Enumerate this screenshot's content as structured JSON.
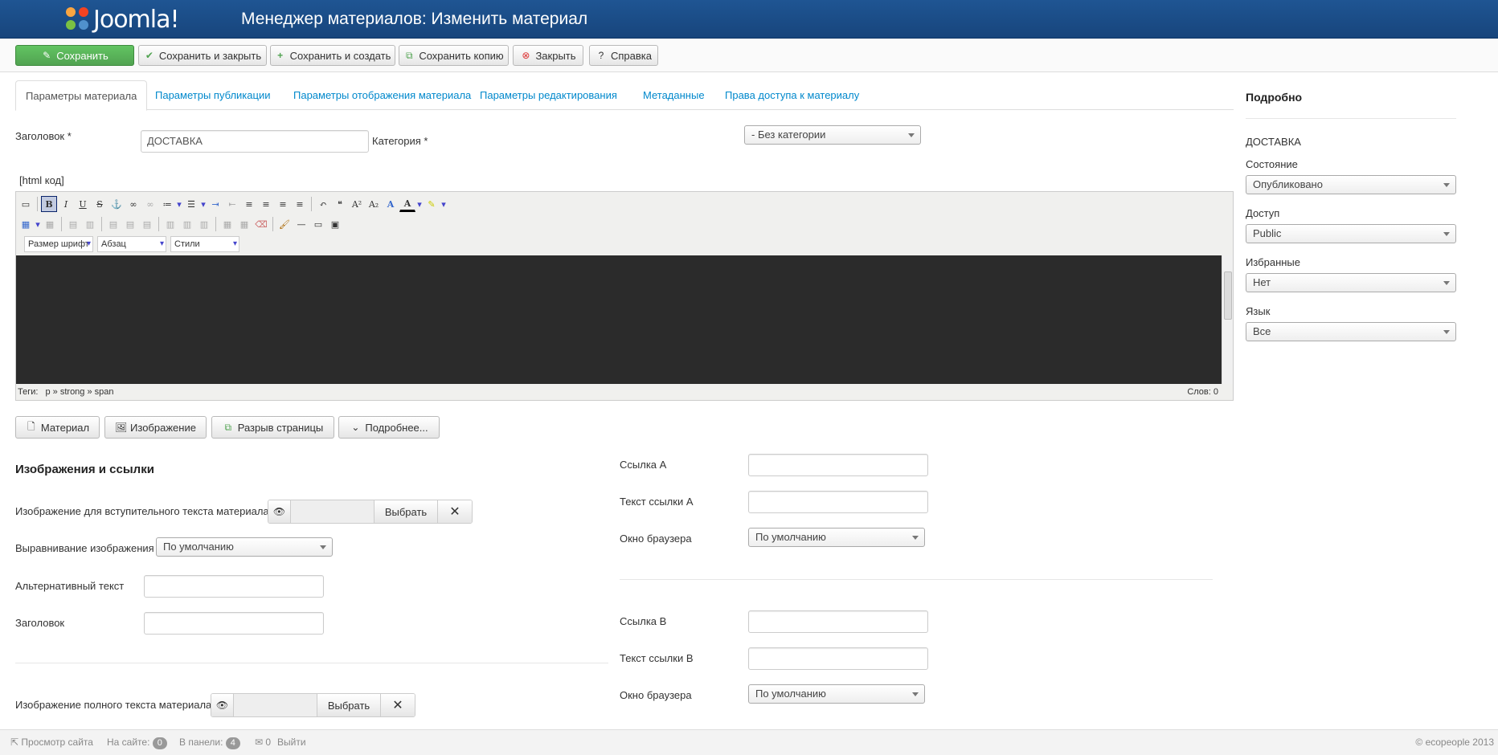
{
  "header": {
    "logo_text": "Joomla!",
    "title": "Менеджер материалов: Изменить материал"
  },
  "toolbar": {
    "save": "Сохранить",
    "save_close": "Сохранить и закрыть",
    "save_new": "Сохранить и создать",
    "save_copy": "Сохранить копию",
    "close": "Закрыть",
    "help": "Справка"
  },
  "tabs": [
    "Параметры материала",
    "Параметры публикации",
    "Параметры отображения материала",
    "Параметры редактирования",
    "Метаданные",
    "Права доступа к материалу"
  ],
  "form": {
    "title_label": "Заголовок *",
    "title_value": "ДОСТАВКА",
    "category_label": "Категория *",
    "category_value": "- Без категории",
    "html_toggle": "[html код]"
  },
  "editor": {
    "font_size": "Размер шрифт",
    "format": "Абзац",
    "styles": "Стили",
    "path_label": "Теги:",
    "path": "p » strong » span",
    "word_count": "Слов: 0"
  },
  "editor_buttons": {
    "article": "Материал",
    "image": "Изображение",
    "pagebreak": "Разрыв страницы",
    "readmore": "Подробнее..."
  },
  "images": {
    "heading": "Изображения и ссылки",
    "intro_image_label": "Изображение для вступительного текста материала",
    "select": "Выбрать",
    "align_label": "Выравнивание изображения",
    "align_value": "По умолчанию",
    "alt_label": "Альтернативный текст",
    "caption_label": "Заголовок",
    "full_image_label": "Изображение полного текста материала"
  },
  "links": {
    "link_a_label": "Ссылка A",
    "link_a_text_label": "Текст ссылки A",
    "window_label": "Окно браузера",
    "window_value": "По умолчанию",
    "link_b_label": "Ссылка B",
    "link_b_text_label": "Текст ссылки B"
  },
  "sidebar": {
    "title": "Подробно",
    "article_title": "ДОСТАВКА",
    "state_label": "Состояние",
    "state_value": "Опубликовано",
    "access_label": "Доступ",
    "access_value": "Public",
    "featured_label": "Избранные",
    "featured_value": "Нет",
    "language_label": "Язык",
    "language_value": "Все"
  },
  "footer": {
    "view_site": "Просмотр сайта",
    "on_site": "На сайте:",
    "on_site_count": "0",
    "in_panel": "В панели:",
    "in_panel_count": "4",
    "messages_count": "0",
    "logout": "Выйти",
    "copyright": "© ecopeople 2013"
  }
}
